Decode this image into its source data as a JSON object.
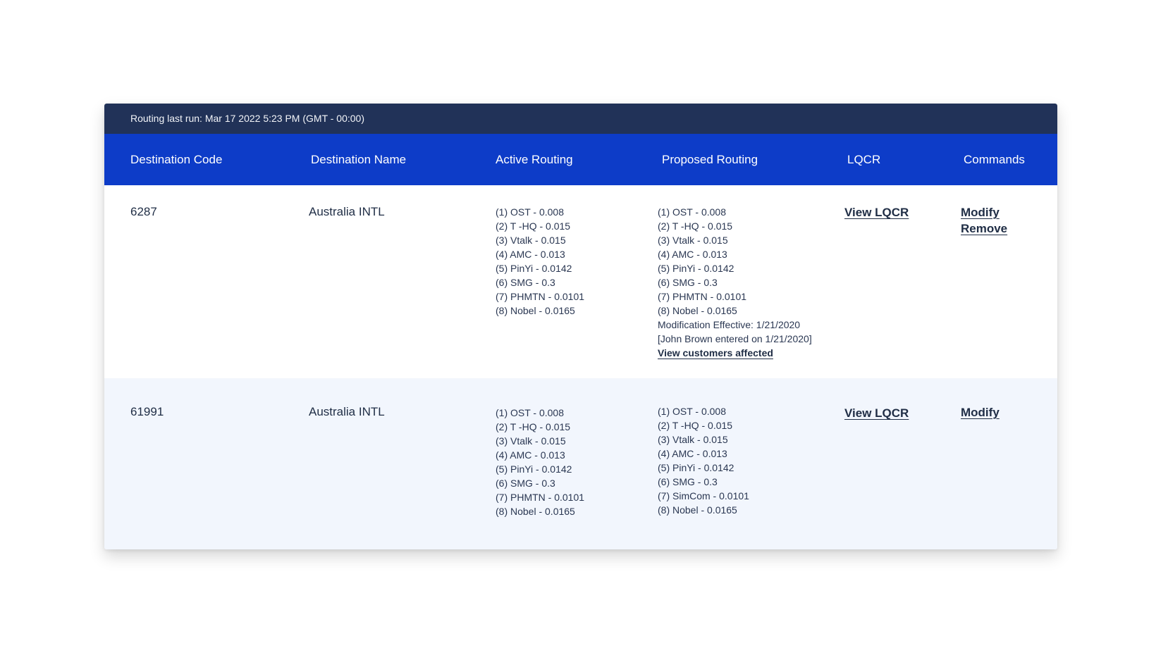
{
  "status_bar": {
    "text": "Routing last run: Mar 17 2022 5:23 PM (GMT - 00:00)"
  },
  "table": {
    "headers": {
      "destination_code": "Destination Code",
      "destination_name": "Destination Name",
      "active_routing": "Active Routing",
      "proposed_routing": "Proposed Routing",
      "lqcr": "LQCR",
      "commands": "Commands"
    },
    "rows": [
      {
        "destination_code": "6287",
        "destination_name": "Australia INTL",
        "active_routing": [
          "(1) OST - 0.008",
          "(2) T -HQ - 0.015",
          "(3) Vtalk - 0.015",
          "(4) AMC - 0.013",
          "(5) PinYi - 0.0142",
          "(6) SMG - 0.3",
          "(7) PHMTN - 0.0101",
          "(8) Nobel - 0.0165"
        ],
        "proposed_routing": [
          "(1) OST - 0.008",
          "(2) T -HQ - 0.015",
          "(3) Vtalk - 0.015",
          "(4) AMC - 0.013",
          "(5) PinYi - 0.0142",
          "(6) SMG - 0.3",
          "(7) PHMTN - 0.0101",
          "(8) Nobel - 0.0165"
        ],
        "modification_effective": "Modification Effective: 1/21/2020",
        "entered_by": "[John Brown entered on 1/21/2020]",
        "view_customers_affected": "View customers affected",
        "lqcr_link": "View LQCR",
        "commands": [
          "Modify",
          "Remove"
        ]
      },
      {
        "destination_code": "61991",
        "destination_name": "Australia INTL",
        "active_routing": [
          "(1) OST - 0.008",
          "(2) T -HQ - 0.015",
          "(3) Vtalk - 0.015",
          "(4) AMC - 0.013",
          "(5) PinYi - 0.0142",
          "(6) SMG - 0.3",
          "(7) PHMTN - 0.0101",
          "(8) Nobel - 0.0165"
        ],
        "proposed_routing": [
          "(1) OST - 0.008",
          "(2) T -HQ - 0.015",
          "(3) Vtalk - 0.015",
          "(4) AMC - 0.013",
          "(5) PinYi - 0.0142",
          "(6) SMG - 0.3",
          "(7) SimCom - 0.0101",
          "(8) Nobel - 0.0165"
        ],
        "lqcr_link": "View LQCR",
        "commands": [
          "Modify"
        ]
      }
    ]
  },
  "colors": {
    "status_bar_bg": "#213258",
    "header_bg": "#0d3cc8",
    "row_alt_bg": "#f2f6fd",
    "text": "#1f2d45"
  }
}
